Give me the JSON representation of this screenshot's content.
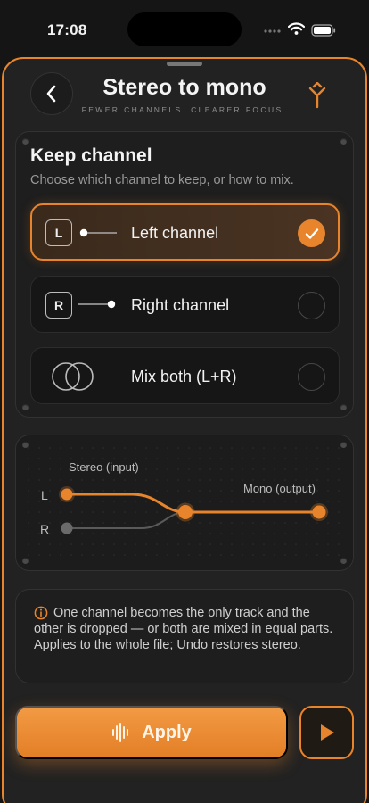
{
  "status_bar": {
    "time": "17:08"
  },
  "header": {
    "title": "Stereo to mono",
    "subtitle": "FEWER CHANNELS. CLEARER FOCUS.",
    "back_icon": "chevron-left-icon",
    "action_icon": "merge-icon"
  },
  "keep_channel": {
    "title": "Keep channel",
    "subtitle": "Choose which channel to keep, or how to mix.",
    "options": [
      {
        "key": "L",
        "label": "Left channel",
        "selected": true
      },
      {
        "key": "R",
        "label": "Right channel",
        "selected": false
      },
      {
        "key": "",
        "label": "Mix both (L+R)",
        "selected": false
      }
    ]
  },
  "diagram": {
    "input_label": "Stereo (input)",
    "output_label": "Mono (output)",
    "left_label": "L",
    "right_label": "R"
  },
  "info": {
    "icon": "info-icon",
    "text": "One channel becomes the only track and the other is dropped — or both are mixed in equal parts. Applies to the whole file; Undo restores stereo."
  },
  "actions": {
    "apply_label": "Apply",
    "apply_icon": "waveform-icon",
    "play_icon": "play-icon"
  },
  "colors": {
    "accent": "#e8842c",
    "background": "#151515",
    "card": "#1e1e1e"
  }
}
